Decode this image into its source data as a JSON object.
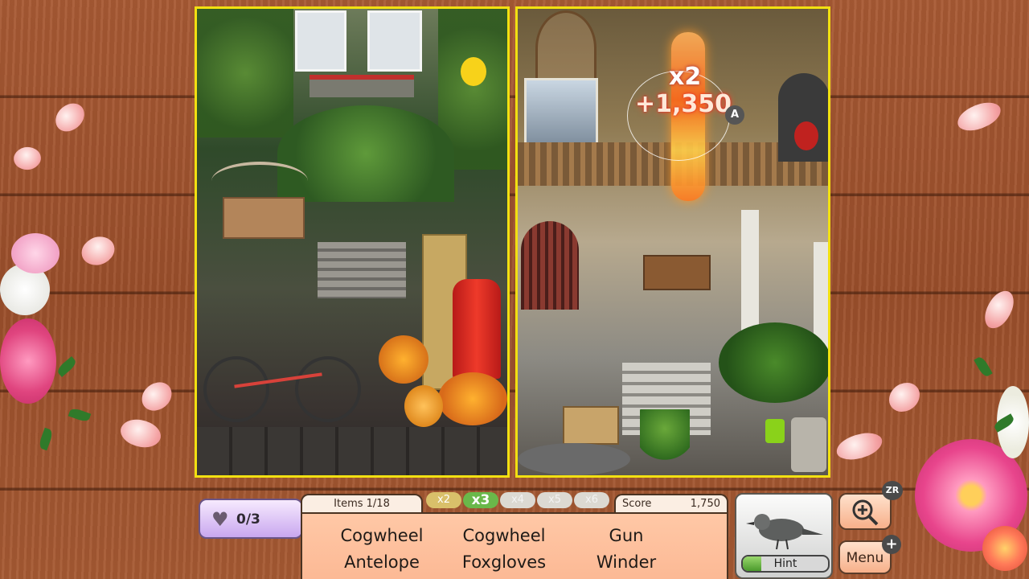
{
  "lives": {
    "icon": "heart-icon",
    "value": "0/3"
  },
  "items": {
    "label": "Items",
    "value": "1/18"
  },
  "score": {
    "label": "Score",
    "value": "1,750"
  },
  "multipliers": [
    {
      "label": "x2",
      "state": "passed"
    },
    {
      "label": "x3",
      "state": "active"
    },
    {
      "label": "x4",
      "state": "locked"
    },
    {
      "label": "x5",
      "state": "locked"
    },
    {
      "label": "x6",
      "state": "locked"
    }
  ],
  "word_list": [
    [
      "Cogwheel",
      "Cogwheel",
      "Gun"
    ],
    [
      "Antelope",
      "Foxgloves",
      "Winder"
    ]
  ],
  "hint": {
    "label": "Hint",
    "icon": "bird-icon",
    "progress": 0.22
  },
  "zoom": {
    "icon": "zoom-in-icon",
    "badge": "ZR"
  },
  "menu": {
    "label": "Menu",
    "badge": "+"
  },
  "combo_popup": {
    "multiplier": "x2",
    "points": "+1,350",
    "cursor_badge": "A"
  },
  "colors": {
    "frame": "#f2e011",
    "wood": "#a85a34",
    "list_bg": "#ffc8a6"
  }
}
